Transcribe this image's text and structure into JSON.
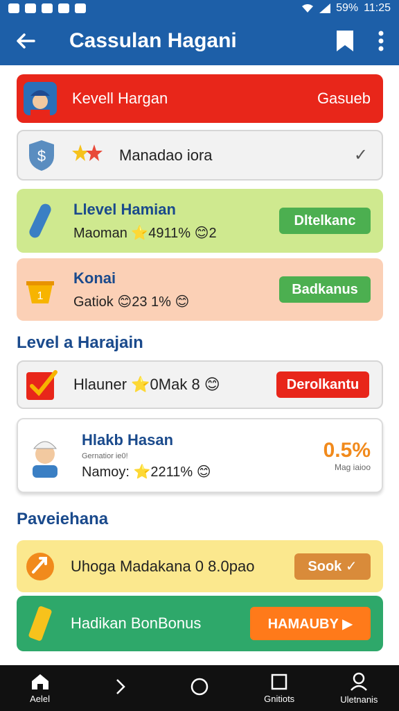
{
  "status_bar": {
    "battery": "59%",
    "time": "11:25"
  },
  "app_bar": {
    "title": "Cassulan Hagani"
  },
  "cards": [
    {
      "title": "Kevell Hargan",
      "action": "Gasueb",
      "color": "#e8261a"
    },
    {
      "title": "Manadao iora",
      "check": "✓",
      "color": "#f2f2f2"
    },
    {
      "title": "Llevel Hamian",
      "subtitle": "Maoman ⭐4911% 😊2",
      "button": "Dltelkanc",
      "color": "#cfe98f"
    },
    {
      "title": "Konai",
      "subtitle": "Gatiok 😊23 1% 😊",
      "button": "Badkanus",
      "color": "#fbd0b6"
    }
  ],
  "sections": [
    {
      "title": "Level a Harajain"
    },
    {
      "title": "Paveiehana"
    }
  ],
  "level_cards": [
    {
      "title": "Hlauner ⭐0Mak 8 😊",
      "button": "Derolkantu"
    },
    {
      "title": "Hlakb Hasan",
      "sub": "Gernatior ie0!",
      "line": "Namoy: ⭐2211% 😊",
      "pct": "0.5%",
      "pct_sub": "Mag iaioo"
    }
  ],
  "bottom_cards": [
    {
      "title": "Uhoga Madakana 0 8.0pao",
      "button": "Sook ✓"
    },
    {
      "title": "Hadikan BonBonus",
      "button": "HAMAUBY ▶"
    }
  ],
  "bottom_nav": [
    {
      "label": "Aelel",
      "icon": "home-icon"
    },
    {
      "label": "",
      "icon": "chevron-icon"
    },
    {
      "label": "",
      "icon": "circle-icon"
    },
    {
      "label": "Gnitiots",
      "icon": "square-icon"
    },
    {
      "label": "Uletnanis",
      "icon": "person-icon"
    }
  ],
  "colors": {
    "primary": "#1d5fa8",
    "red": "#e8261a",
    "green": "#4caf50",
    "orange": "#ff7a1a"
  }
}
